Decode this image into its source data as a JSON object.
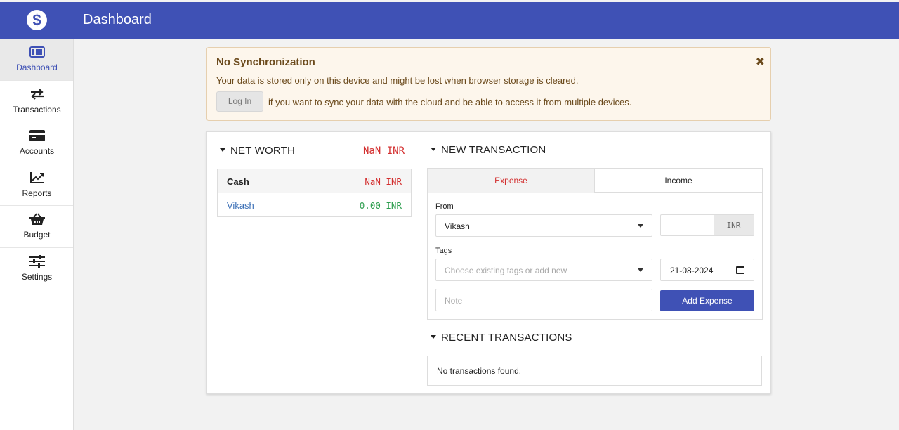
{
  "header": {
    "title": "Dashboard",
    "logo_icon": "dollar-icon"
  },
  "colors": {
    "primary": "#3f51b5",
    "expense": "#d32f2f",
    "positive": "#2e9e4f",
    "link": "#3b6fb6"
  },
  "sidebar": {
    "items": [
      {
        "label": "Dashboard",
        "icon": "dashboard-icon",
        "active": true
      },
      {
        "label": "Transactions",
        "icon": "transfer-arrows-icon"
      },
      {
        "label": "Accounts",
        "icon": "credit-card-icon"
      },
      {
        "label": "Reports",
        "icon": "line-chart-icon"
      },
      {
        "label": "Budget",
        "icon": "basket-icon"
      },
      {
        "label": "Settings",
        "icon": "sliders-icon"
      }
    ]
  },
  "alert": {
    "title": "No Synchronization",
    "message": "Your data is stored only on this device and might be lost when browser storage is cleared.",
    "login_label": "Log In",
    "login_message": "if you want to sync your data with the cloud and be able to access it from multiple devices.",
    "close_icon": "close-icon"
  },
  "net_worth": {
    "heading": "NET WORTH",
    "total": "NaN INR",
    "groups": [
      {
        "name": "Cash",
        "value": "NaN INR",
        "accounts": [
          {
            "name": "Vikash",
            "value": "0.00 INR"
          }
        ]
      }
    ]
  },
  "new_transaction": {
    "heading": "NEW TRANSACTION",
    "tabs": [
      {
        "label": "Expense",
        "active": true
      },
      {
        "label": "Income"
      }
    ],
    "from_label": "From",
    "from_value": "Vikash",
    "amount_value": "",
    "currency": "INR",
    "tags_label": "Tags",
    "tags_placeholder": "Choose existing tags or add new",
    "date_value": "21-08-2024",
    "note_placeholder": "Note",
    "submit_label": "Add Expense"
  },
  "recent_transactions": {
    "heading": "RECENT TRANSACTIONS",
    "empty_message": "No transactions found."
  }
}
